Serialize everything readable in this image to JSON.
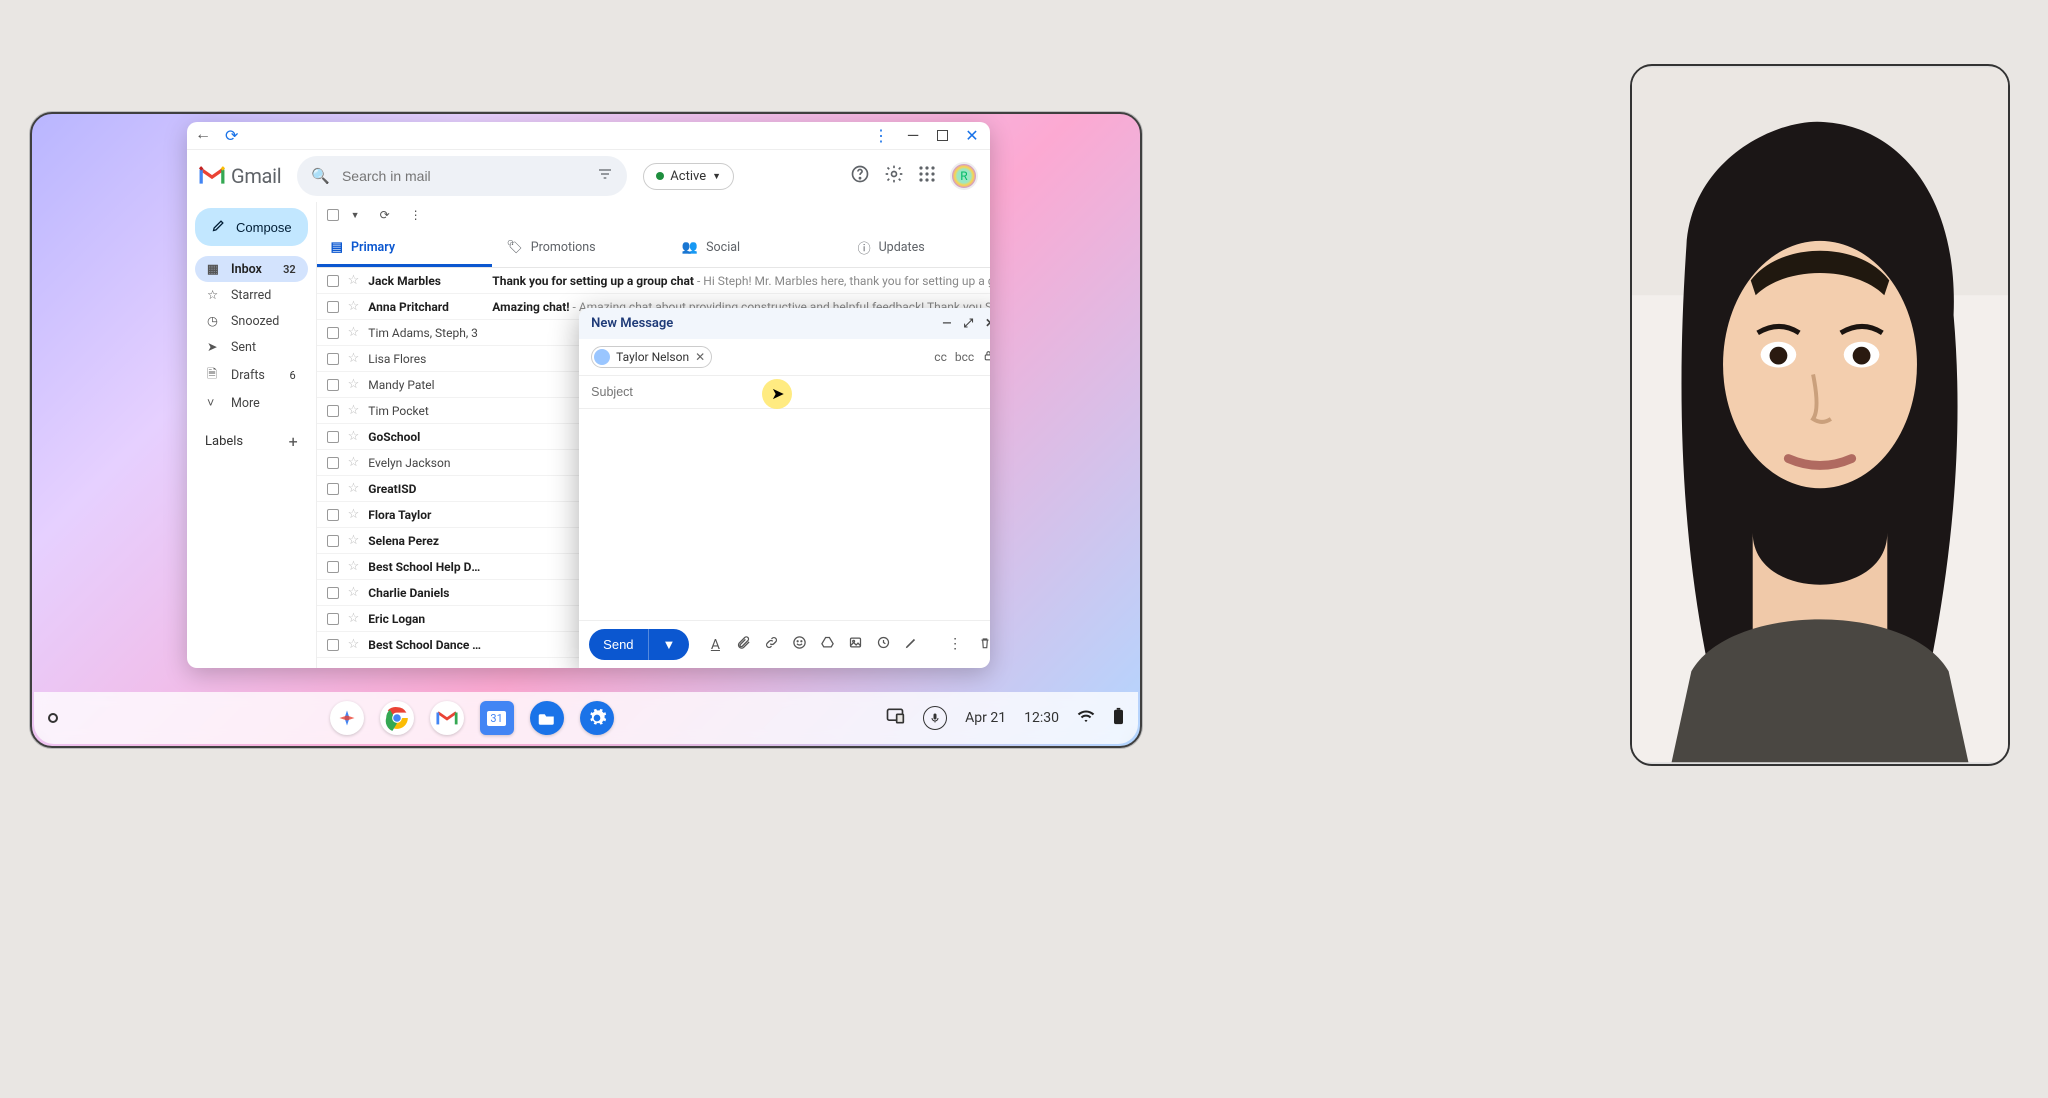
{
  "window": {
    "app_name": "Gmail",
    "search_placeholder": "Search in mail",
    "status_label": "Active",
    "avatar_letter": "R"
  },
  "sidebar": {
    "compose_label": "Compose",
    "items": [
      {
        "icon": "inbox",
        "label": "Inbox",
        "count": "32",
        "active": true
      },
      {
        "icon": "star",
        "label": "Starred"
      },
      {
        "icon": "clock",
        "label": "Snoozed"
      },
      {
        "icon": "send",
        "label": "Sent"
      },
      {
        "icon": "file",
        "label": "Drafts",
        "count": "6"
      },
      {
        "icon": "more",
        "label": "More"
      }
    ],
    "labels_header": "Labels"
  },
  "tabs": [
    {
      "icon": "inbox",
      "label": "Primary",
      "active": true
    },
    {
      "icon": "tag",
      "label": "Promotions"
    },
    {
      "icon": "people",
      "label": "Social"
    },
    {
      "icon": "info",
      "label": "Updates"
    }
  ],
  "emails": [
    {
      "sender": "Jack Marbles",
      "subject": "Thank you for setting up a group chat",
      "preview": " - Hi Steph! Mr. Marbles here, thank you for setting up a gro",
      "unread": true
    },
    {
      "sender": "Anna Pritchard",
      "subject": "Amazing chat!",
      "preview": " - Amazing chat about providing constructive and helpful feedback! Thank you Step",
      "unread": true
    },
    {
      "sender": "Tim Adams, Steph, 3",
      "subject": "",
      "preview": "",
      "unread": false
    },
    {
      "sender": "Lisa Flores",
      "subject": "",
      "preview": ""
    },
    {
      "sender": "Mandy Patel",
      "subject": "",
      "preview": ""
    },
    {
      "sender": "Tim Pocket",
      "subject": "",
      "preview": ""
    },
    {
      "sender": "GoSchool",
      "subject": "",
      "preview": "",
      "unread": true
    },
    {
      "sender": "Evelyn Jackson",
      "subject": "",
      "preview": ""
    },
    {
      "sender": "GreatISD",
      "subject": "",
      "preview": "",
      "unread": true
    },
    {
      "sender": "Flora Taylor",
      "subject": "",
      "preview": "",
      "unread": true
    },
    {
      "sender": "Selena Perez",
      "subject": "",
      "preview": "",
      "unread": true
    },
    {
      "sender": "Best School Help Desk",
      "subject": "",
      "preview": "",
      "unread": true
    },
    {
      "sender": "Charlie Daniels",
      "subject": "",
      "preview": "",
      "unread": true
    },
    {
      "sender": "Eric Logan",
      "subject": "",
      "preview": "",
      "unread": true
    },
    {
      "sender": "Best School Dance Troupe",
      "subject": "",
      "preview": "",
      "unread": true
    }
  ],
  "compose": {
    "title": "New Message",
    "recipient": "Taylor Nelson",
    "subject_placeholder": "Subject",
    "cc": "cc",
    "bcc": "bcc",
    "send_label": "Send"
  },
  "shelf": {
    "date": "Apr 21",
    "time": "12:30"
  }
}
